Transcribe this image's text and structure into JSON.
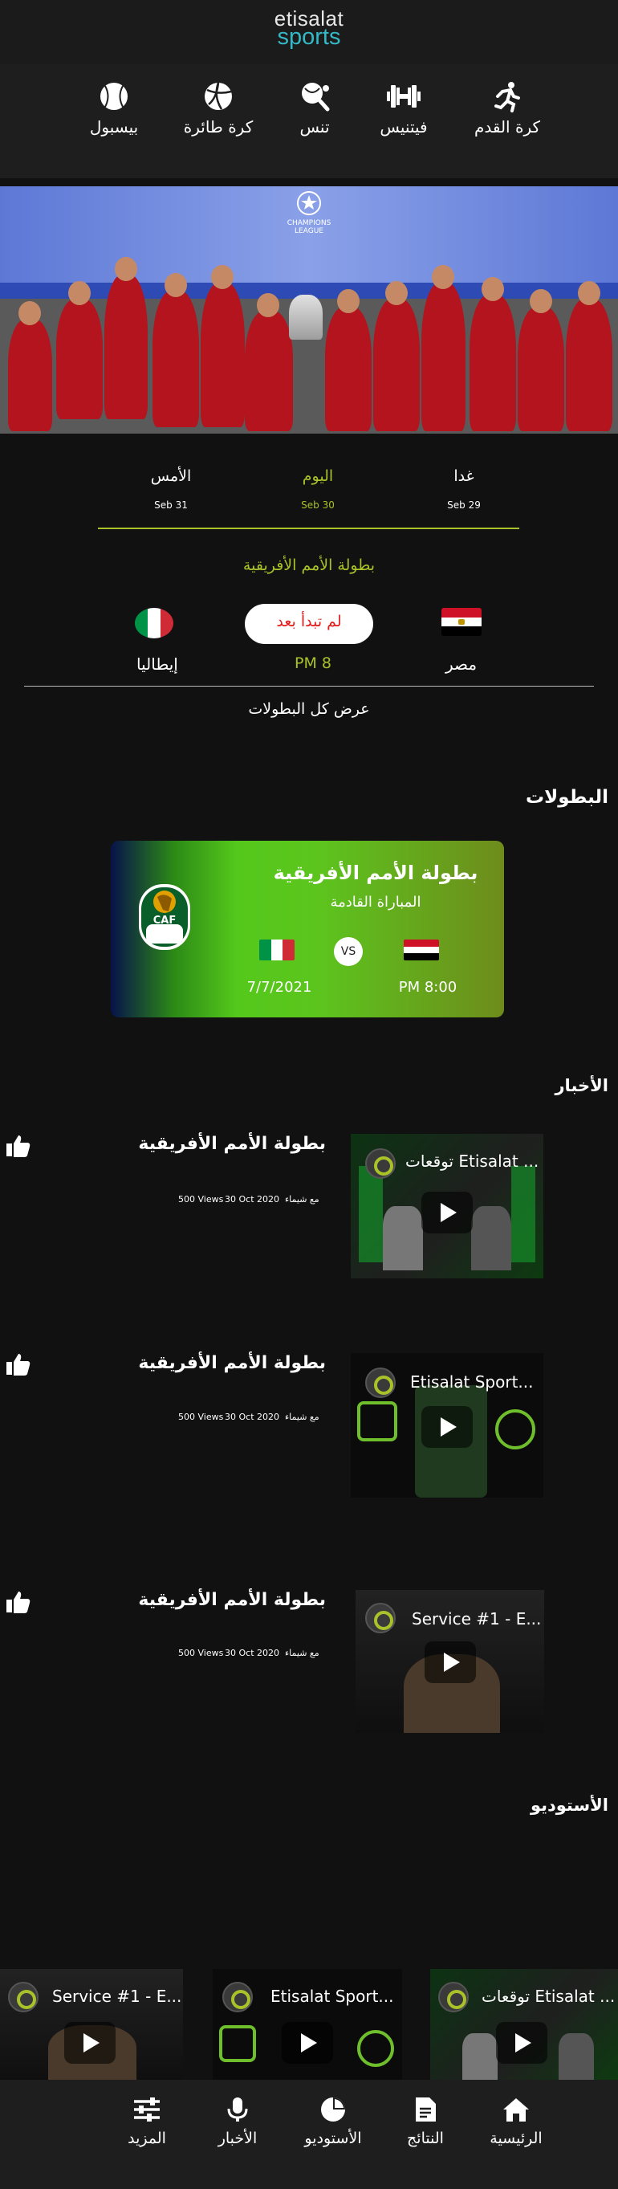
{
  "brand": {
    "name_top": "etisalat",
    "name_bottom": "sports"
  },
  "categories": [
    {
      "label": "كرة القدم",
      "icon": "running-icon"
    },
    {
      "label": "فيتنيس",
      "icon": "dumbbell-icon"
    },
    {
      "label": "تنس",
      "icon": "tennis-icon"
    },
    {
      "label": "كرة طائرة",
      "icon": "volleyball-icon"
    },
    {
      "label": "بيسبول",
      "icon": "baseball-icon"
    }
  ],
  "hero": {
    "caption": "CHAMPIONS LEAGUE"
  },
  "dates": [
    {
      "day": "غدا",
      "date": "Seb 29"
    },
    {
      "day": "اليوم",
      "date": "Seb 30"
    },
    {
      "day": "الأمس",
      "date": "Seb 31"
    }
  ],
  "match": {
    "tournament": "بطولة الأمم الأفريقية",
    "home": "مصر",
    "away": "إيطاليا",
    "status": "لم تبدأ بعد",
    "time": "PM 8"
  },
  "view_all": "عرض كل البطولات",
  "tournaments": {
    "heading": "البطولات",
    "card": {
      "title": "بطولة الأمم الأفريقية",
      "subtitle": "المباراة القادمة",
      "vs": "VS",
      "time": "PM 8:00",
      "date": "7/7/2021",
      "badge_text": "CAF"
    }
  },
  "news": {
    "heading": "الأخبار",
    "items": [
      {
        "title": "بطولة الأمم الأفريقية",
        "author": "مع شيماء",
        "date": "30 Oct 2020",
        "views": "500 Views",
        "video_title": "توقعات Etisalat ..."
      },
      {
        "title": "بطولة الأمم الأفريقية",
        "author": "مع شيماء",
        "date": "30 Oct 2020",
        "views": "500 Views",
        "video_title": "Etisalat Sport..."
      },
      {
        "title": "بطولة الأمم الأفريقية",
        "author": "مع شيماء",
        "date": "30 Oct 2020",
        "views": "500 Views",
        "video_title": "Service #1 - E..."
      }
    ]
  },
  "studio": {
    "heading": "الأستوديو",
    "videos": [
      {
        "title": "Service #1 - E..."
      },
      {
        "title": "Etisalat Sport..."
      },
      {
        "title": "توقعات Etisalat ..."
      }
    ]
  },
  "nav": [
    {
      "label": "الرئيسية",
      "icon": "home-icon"
    },
    {
      "label": "النتائج",
      "icon": "document-icon"
    },
    {
      "label": "الأستوديو",
      "icon": "pie-chart-icon"
    },
    {
      "label": "الأخبار",
      "icon": "microphone-icon"
    },
    {
      "label": "المزيد",
      "icon": "sliders-icon"
    }
  ],
  "colors": {
    "accent": "#a9c229",
    "background": "#111111",
    "status_red": "#e21b1b"
  }
}
